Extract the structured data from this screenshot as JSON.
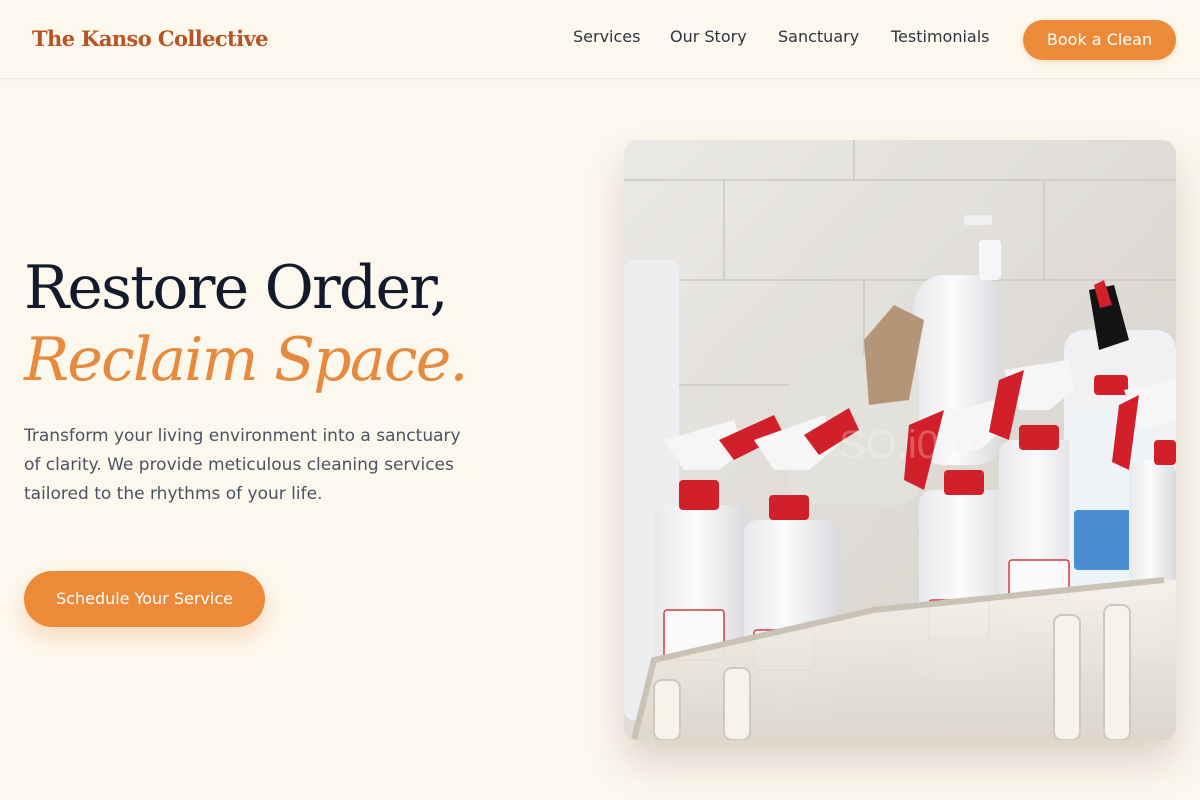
{
  "brand": {
    "name": "The Kanso Collective",
    "color": "#b65424"
  },
  "nav": {
    "items": [
      {
        "label": "Services"
      },
      {
        "label": "Our Story"
      },
      {
        "label": "Sanctuary"
      },
      {
        "label": "Testimonials"
      }
    ],
    "cta_label": "Book a Clean"
  },
  "hero": {
    "title_line1": "Restore Order,",
    "title_line2": "Reclaim Space.",
    "description": "Transform your living environment into a sanctuary of clarity. We provide meticulous cleaning services tailored to the rhythms of your life.",
    "cta_label": "Schedule Your Service",
    "image_subject": "spray-bottles-in-caddy"
  },
  "colors": {
    "background": "#fdf8ee",
    "accent": "#ec8a3a",
    "heading": "#131a2b",
    "body_text": "#4b5262"
  }
}
